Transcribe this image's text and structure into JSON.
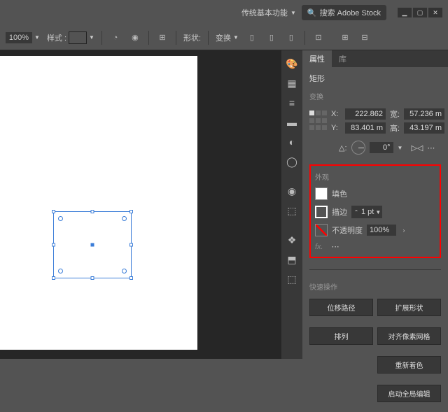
{
  "topbar": {
    "workspace": "传统基本功能",
    "search_placeholder": "搜索 Adobe Stock"
  },
  "options": {
    "opacity": "100%",
    "style_label": "样式 :",
    "shape_label": "形状:",
    "transform_label": "变换"
  },
  "tabs": {
    "properties": "属性",
    "library": "库"
  },
  "properties": {
    "object_type": "矩形",
    "transform_label": "变换",
    "x_label": "X:",
    "y_label": "Y:",
    "w_label": "宽:",
    "h_label": "高:",
    "x": "222.862",
    "y": "83.401 m",
    "w": "57.236 m",
    "h": "43.197 m",
    "angle_label": "△:",
    "angle": "0°"
  },
  "appearance": {
    "section": "外观",
    "fill": "填色",
    "stroke": "描边",
    "stroke_weight": "1 pt",
    "opacity_label": "不透明度",
    "opacity": "100%",
    "fx": "fx."
  },
  "quick": {
    "section": "快速操作",
    "offset_path": "位移路径",
    "expand_shape": "扩展形状",
    "arrange": "排列",
    "align_pixel": "对齐像素网格",
    "recolor": "重新着色",
    "global_edit": "启动全局编辑"
  }
}
